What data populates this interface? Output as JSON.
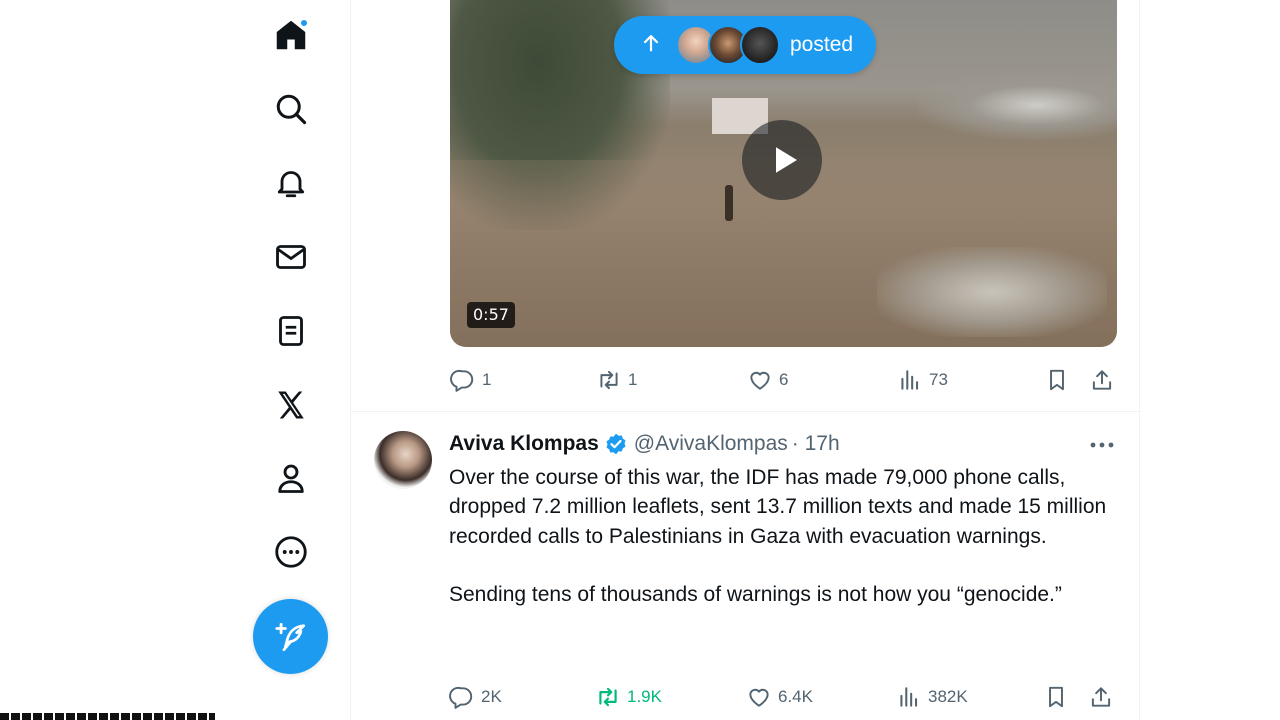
{
  "nav": {
    "items": [
      {
        "name": "home",
        "has_dot": true
      },
      {
        "name": "explore"
      },
      {
        "name": "notifications"
      },
      {
        "name": "messages"
      },
      {
        "name": "lists"
      },
      {
        "name": "premium-x"
      },
      {
        "name": "profile"
      },
      {
        "name": "more"
      }
    ],
    "compose_icon": "feather-plus-icon"
  },
  "top_post": {
    "video_duration": "0:57",
    "new_posts_label": "posted",
    "actions": {
      "replies": "1",
      "reposts": "1",
      "likes": "6",
      "views": "73"
    }
  },
  "post": {
    "author_name": "Aviva Klompas",
    "handle": "@AvivaKlompas",
    "time": "· 17h",
    "verified": true,
    "paragraph1": "Over the course of this war, the IDF has made 79,000 phone calls, dropped 7.2 million leaflets, sent 13.7 million texts and made 15 million recorded calls to Palestinians in Gaza with evacuation warnings.",
    "paragraph2": "Sending tens of thousands of warnings is not how you “genocide.”",
    "actions": {
      "replies": "2K",
      "reposts": "1.9K",
      "likes": "6.4K",
      "views": "382K"
    }
  },
  "colors": {
    "accent": "#1d9bf0",
    "muted": "#536471",
    "repost_active": "#00ba7c",
    "text": "#0f1419"
  }
}
